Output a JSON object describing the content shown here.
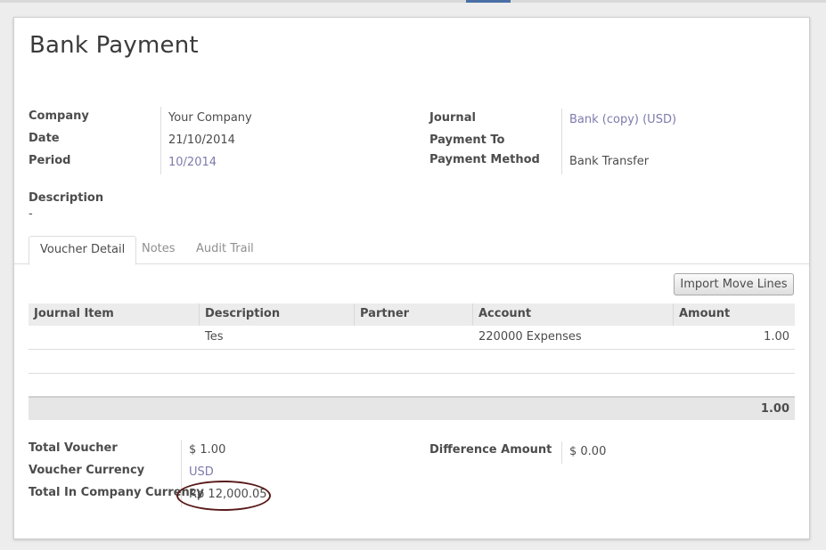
{
  "form": {
    "title": "Bank Payment",
    "left_fields": [
      {
        "label": "Company",
        "value": "Your Company"
      },
      {
        "label": "Date",
        "value": "21/10/2014"
      },
      {
        "label": "Period",
        "value": "10/2014"
      }
    ],
    "right_fields": [
      {
        "label": "Journal",
        "value": "Bank (copy) (USD)"
      },
      {
        "label": "Payment To",
        "value": ""
      },
      {
        "label": "Payment Method",
        "value": "Bank Transfer"
      }
    ],
    "description_label": "Description",
    "description_value": "-"
  },
  "tabs": [
    {
      "label": "Voucher Detail",
      "active": true
    },
    {
      "label": "Notes",
      "active": false
    },
    {
      "label": "Audit Trail",
      "active": false
    }
  ],
  "import_button_label": "Import Move Lines",
  "table": {
    "columns": [
      "Journal Item",
      "Description",
      "Partner",
      "Account",
      "Amount"
    ],
    "rows": [
      {
        "journal_item": "",
        "description": "Tes",
        "partner": "",
        "account": "220000 Expenses",
        "amount": "1.00"
      }
    ],
    "total": "1.00"
  },
  "totals": {
    "total_voucher_label": "Total Voucher",
    "total_voucher_value": "$ 1.00",
    "voucher_currency_label": "Voucher Currency",
    "voucher_currency_value": "USD",
    "company_currency_label": "Total In Company Currency",
    "company_currency_value": "Rp 12,000.05",
    "difference_label": "Difference Amount",
    "difference_value": "$ 0.00"
  },
  "colors": {
    "link": "#7c7bad",
    "annotation_circle": "#5a1a1a"
  }
}
